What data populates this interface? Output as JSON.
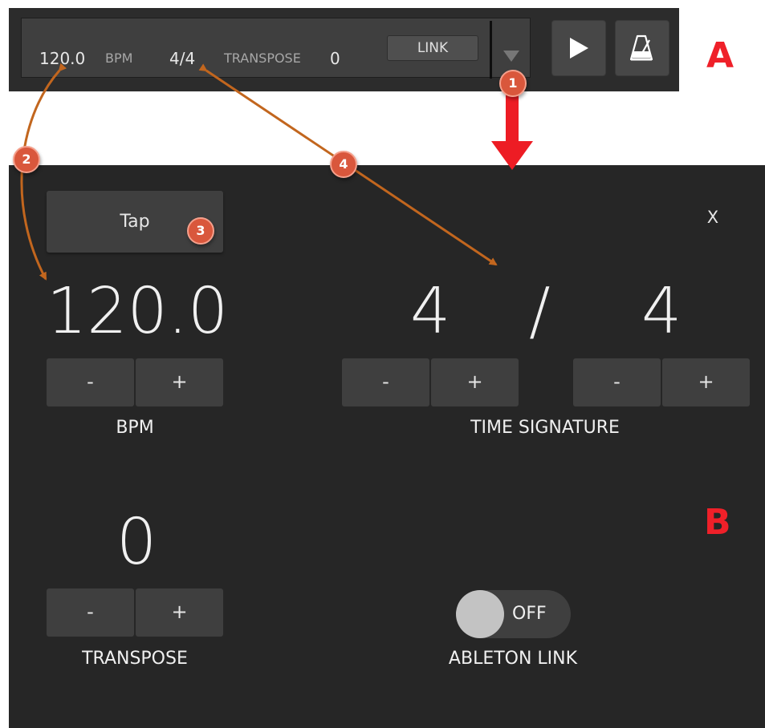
{
  "transport": {
    "bpm_value": "120.0",
    "bpm_label": "BPM",
    "time_signature": "4/4",
    "transpose_label": "TRANSPOSE",
    "transpose_value": "0",
    "link_label": "LINK",
    "dropdown_icon": "triangle-down-icon",
    "play_icon": "play-icon",
    "metronome_icon": "metronome-icon"
  },
  "labels": {
    "section_a": "A",
    "section_b": "B"
  },
  "panel": {
    "tap_label": "Tap",
    "close_label": "X",
    "bpm": {
      "value": "120.0",
      "minus_label": "-",
      "plus_label": "+",
      "caption": "BPM"
    },
    "time_signature": {
      "numerator": "4",
      "separator": "/",
      "denominator": "4",
      "minus_label": "-",
      "plus_label": "+",
      "caption": "TIME SIGNATURE"
    },
    "transpose": {
      "value": "0",
      "minus_label": "-",
      "plus_label": "+",
      "caption": "TRANSPOSE"
    },
    "ableton_link": {
      "state_label": "OFF",
      "caption": "ABLETON LINK"
    }
  },
  "annotations": {
    "badges": [
      "1",
      "2",
      "3",
      "4"
    ]
  },
  "colors": {
    "panel_bg": "#262626",
    "button_bg": "#3f3f3f",
    "accent_red": "#ef2029",
    "annotation_orange": "#d9573c",
    "arrow_brown": "#c2661e"
  }
}
